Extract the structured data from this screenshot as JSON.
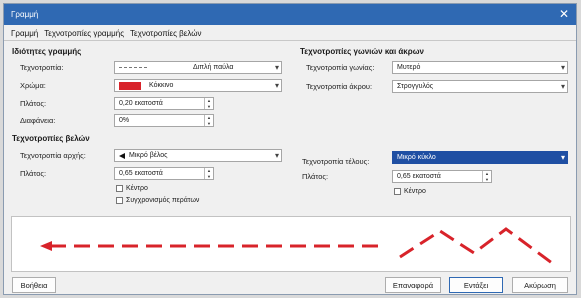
{
  "window": {
    "title": "Γραμμή",
    "close_glyph": "✕"
  },
  "tabs": [
    "Γραμμή",
    "Τεχνοτροπίες γραμμής",
    "Τεχνοτροπίες βελών"
  ],
  "line_props": {
    "heading": "Ιδιότητες γραμμής",
    "style_label": "Τεχνοτροπία:",
    "style_value": "Διπλή παύλα",
    "color_label": "Χρώμα:",
    "color_value": "Κόκκινο",
    "color_hex": "#d8232a",
    "width_label": "Πλάτος:",
    "width_value": "0,20 εκατοστά",
    "transparency_label": "Διαφάνεια:",
    "transparency_value": "0%"
  },
  "corner_props": {
    "heading": "Τεχνοτροπίες γωνιών και άκρων",
    "corner_label": "Τεχνοτροπία γωνίας:",
    "corner_value": "Μυτερό",
    "cap_label": "Τεχνοτροπία άκρου:",
    "cap_value": "Στρογγυλός"
  },
  "arrow_styles": {
    "heading": "Τεχνοτροπίες βελών",
    "start_label": "Τεχνοτροπία αρχής:",
    "start_value": "Μικρό βέλος",
    "start_width_label": "Πλάτος:",
    "start_width_value": "0,65 εκατοστά",
    "start_center_label": "Κέντρο",
    "sync_label": "Συγχρονισμός περάτων",
    "end_label": "Τεχνοτροπία τέλους:",
    "end_value": "Μικρό κύκλο",
    "end_width_label": "Πλάτος:",
    "end_width_value": "0,65 εκατοστά",
    "end_center_label": "Κέντρο"
  },
  "buttons": {
    "help": "Βοήθεια",
    "reset": "Επαναφορά",
    "ok": "Εντάξει",
    "cancel": "Ακύρωση"
  },
  "icons": {
    "dropdown": "▾",
    "spin_up": "▲",
    "spin_down": "▼"
  },
  "colors": {
    "accent": "#2f69b3",
    "selection": "#1f4fa3",
    "preview_line": "#d8232a"
  }
}
